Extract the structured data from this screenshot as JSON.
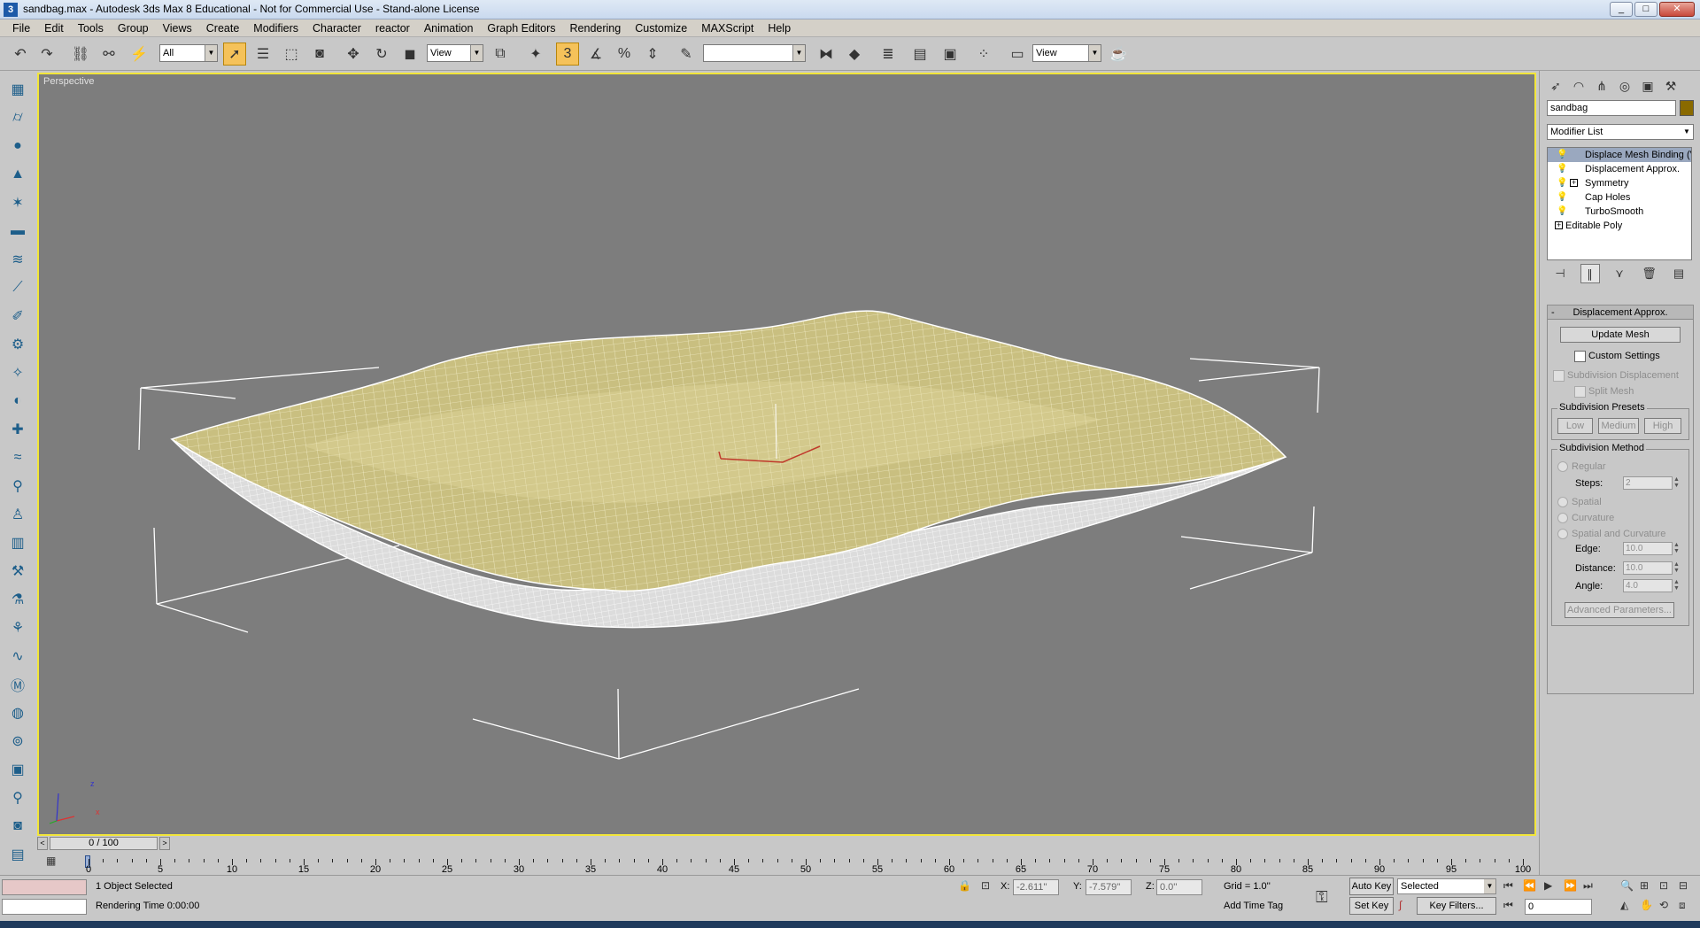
{
  "window": {
    "title": "sandbag.max - Autodesk 3ds Max 8  Educational - Not for Commercial Use - Stand-alone License",
    "minimize": "_",
    "maximize": "□",
    "close": "✕"
  },
  "menu": [
    "File",
    "Edit",
    "Tools",
    "Group",
    "Views",
    "Create",
    "Modifiers",
    "Character",
    "reactor",
    "Animation",
    "Graph Editors",
    "Rendering",
    "Customize",
    "MAXScript",
    "Help"
  ],
  "toolbar": {
    "selection_filter": "All",
    "ref_coord": "View",
    "named_selection": "",
    "render_view": "View",
    "snap_label": "3"
  },
  "viewport": {
    "label": "Perspective",
    "axis_x": "x",
    "axis_z": "z",
    "mesh_color": "#c9bf80",
    "wire_color": "#ffffff",
    "background": "#7d7d7d"
  },
  "command_panel": {
    "object_name": "sandbag",
    "object_color": "#8a6a00",
    "modifier_list": "Modifier List",
    "stack": [
      {
        "label": "Displace Mesh Binding (V",
        "selected": true,
        "has_plus": false
      },
      {
        "label": "Displacement Approx.",
        "selected": false,
        "has_plus": false
      },
      {
        "label": "Symmetry",
        "selected": false,
        "has_plus": true
      },
      {
        "label": "Cap Holes",
        "selected": false,
        "has_plus": false
      },
      {
        "label": "TurboSmooth",
        "selected": false,
        "has_plus": false
      },
      {
        "label": "Editable Poly",
        "selected": false,
        "has_plus": true,
        "base": true
      }
    ],
    "rollout": {
      "title": "Displacement Approx.",
      "minus": "-",
      "update_mesh": "Update Mesh",
      "custom_settings": "Custom Settings",
      "subdivision_displacement": "Subdivision Displacement",
      "split_mesh": "Split Mesh",
      "presets_title": "Subdivision Presets",
      "preset_low": "Low",
      "preset_medium": "Medium",
      "preset_high": "High",
      "method_title": "Subdivision Method",
      "regular": "Regular",
      "steps_label": "Steps:",
      "steps_value": "2",
      "spatial": "Spatial",
      "curvature": "Curvature",
      "spatial_curvature": "Spatial and Curvature",
      "edge_label": "Edge:",
      "edge_value": "10.0",
      "distance_label": "Distance:",
      "distance_value": "10.0",
      "angle_label": "Angle:",
      "angle_value": "4.0",
      "advanced": "Advanced Parameters..."
    }
  },
  "timeline": {
    "slider": "0 / 100",
    "ticks": [
      0,
      5,
      10,
      15,
      20,
      25,
      30,
      35,
      40,
      45,
      50,
      55,
      60,
      65,
      70,
      75,
      80,
      85,
      90,
      95,
      100
    ],
    "prev": "<",
    "next": ">"
  },
  "status": {
    "selection": "1 Object Selected",
    "prompt": "Rendering Time  0:00:00",
    "x_label": "X:",
    "x_value": "-2.611''",
    "y_label": "Y:",
    "y_value": "-7.579''",
    "z_label": "Z:",
    "z_value": "0.0''",
    "grid": "Grid = 1.0''",
    "add_time_tag": "Add Time Tag",
    "auto_key": "Auto Key",
    "set_key": "Set Key",
    "selected": "Selected",
    "key_filters": "Key Filters...",
    "frame": "0"
  }
}
